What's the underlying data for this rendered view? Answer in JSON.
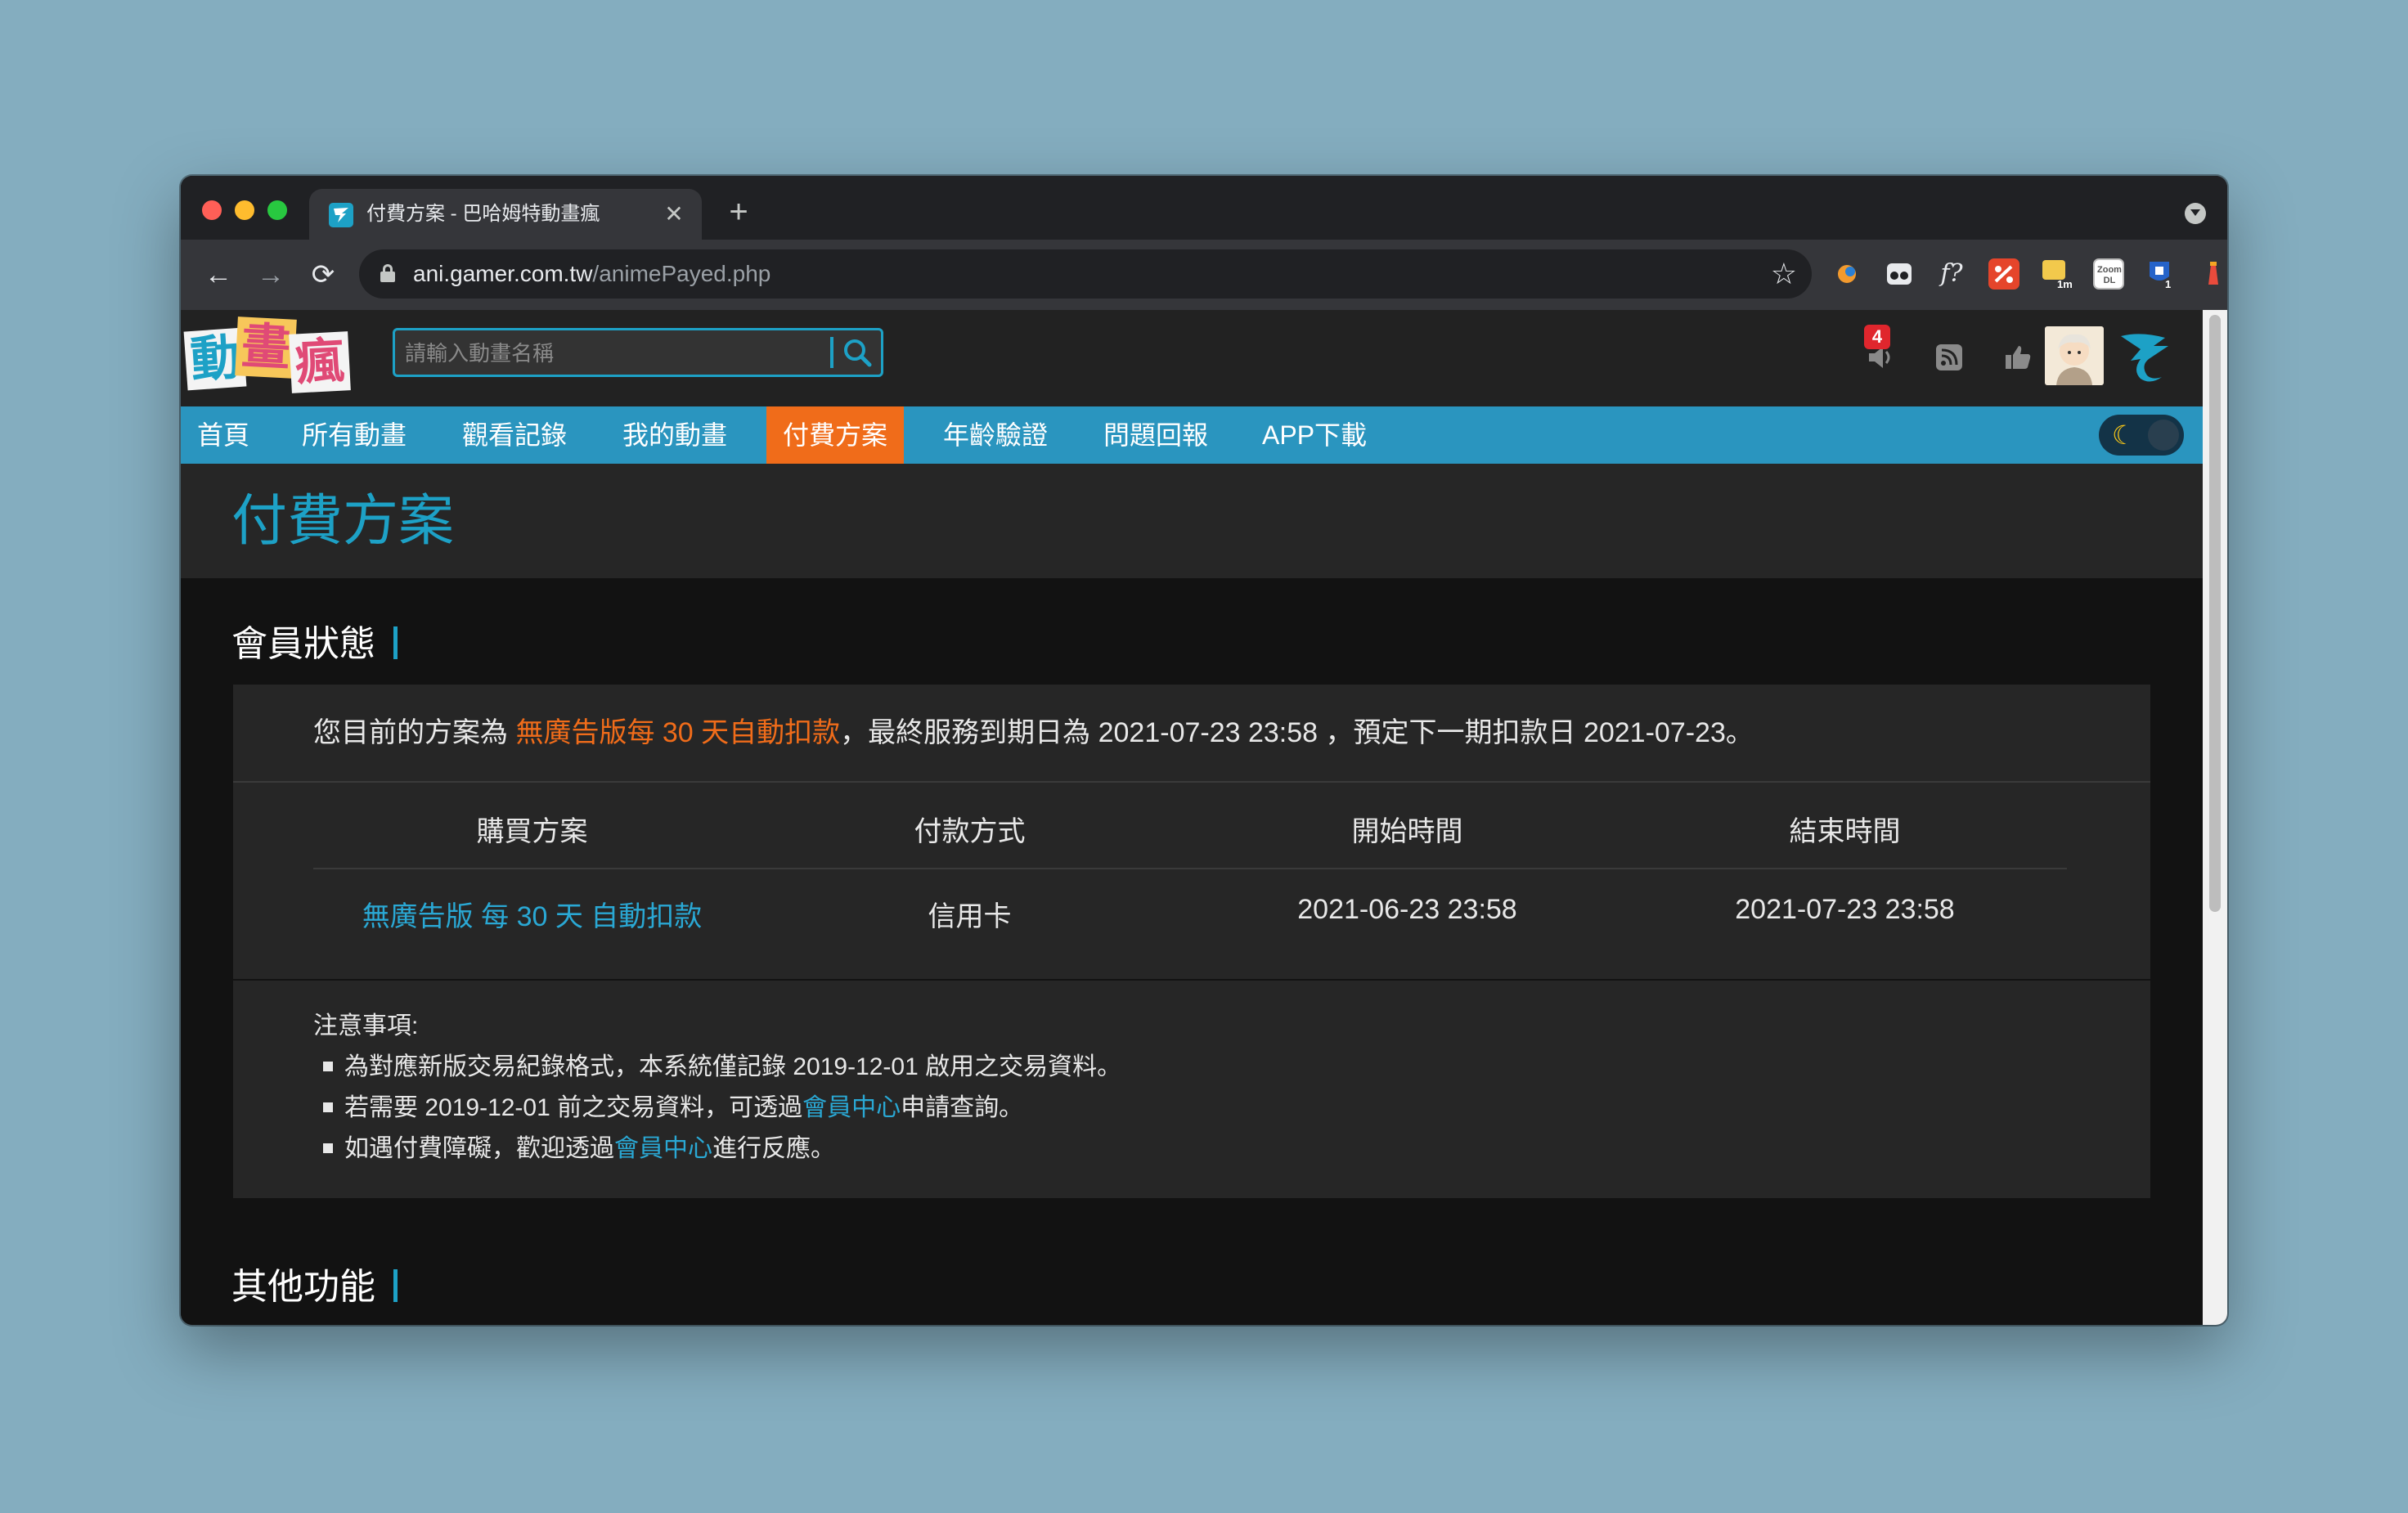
{
  "browser": {
    "tab_title": "付費方案 - 巴哈姆特動畫瘋",
    "new_tab_label": "+",
    "close_tab_label": "✕",
    "url_host": "ani.gamer.com.tw",
    "url_path": "/animePayed.php",
    "extensions": [
      {
        "name": "extension-1",
        "badge": ""
      },
      {
        "name": "extension-2",
        "badge": ""
      },
      {
        "name": "extension-3",
        "badge": "f?"
      },
      {
        "name": "extension-4",
        "badge": ""
      },
      {
        "name": "extension-5",
        "badge": "1m"
      },
      {
        "name": "extension-6",
        "badge": "Zoom DL"
      },
      {
        "name": "extension-7",
        "badge": "1"
      }
    ]
  },
  "site": {
    "logo_chars": [
      "動",
      "畫",
      "瘋"
    ],
    "search_placeholder": "請輸入動畫名稱",
    "notification_count": "4",
    "nav": [
      "首頁",
      "所有動畫",
      "觀看記錄",
      "我的動畫",
      "付費方案",
      "年齡驗證",
      "問題回報",
      "APP下載"
    ],
    "active_nav": "付費方案"
  },
  "page": {
    "title": "付費方案",
    "member_section_title": "會員狀態",
    "plan_prefix": "您目前的方案為 ",
    "plan_name": "無廣告版每 30 天自動扣款",
    "plan_suffix": "，最終服務到期日為 2021-07-23 23:58 ，預定下一期扣款日 2021-07-23。",
    "table_headers": [
      "購買方案",
      "付款方式",
      "開始時間",
      "結束時間"
    ],
    "table_row": {
      "plan": "無廣告版 每 30 天 自動扣款",
      "payment": "信用卡",
      "start": "2021-06-23 23:58",
      "end": "2021-07-23 23:58"
    },
    "notes_title": "注意事項:",
    "notes": [
      {
        "before": "為對應新版交易紀錄格式，本系統僅記錄 2019-12-01 啟用之交易資料。",
        "link": "",
        "after": ""
      },
      {
        "before": "若需要 2019-12-01 前之交易資料，可透過",
        "link": "會員中心",
        "after": "申請查詢。"
      },
      {
        "before": "如遇付費障礙，歡迎透過",
        "link": "會員中心",
        "after": "進行反應。"
      }
    ],
    "other_section_title": "其他功能"
  },
  "colors": {
    "accent": "#1da1c6",
    "nav_bg": "#2a95bf",
    "active_nav": "#f06c1a",
    "highlight_orange": "#f06c1a",
    "link": "#2aa8d4"
  }
}
